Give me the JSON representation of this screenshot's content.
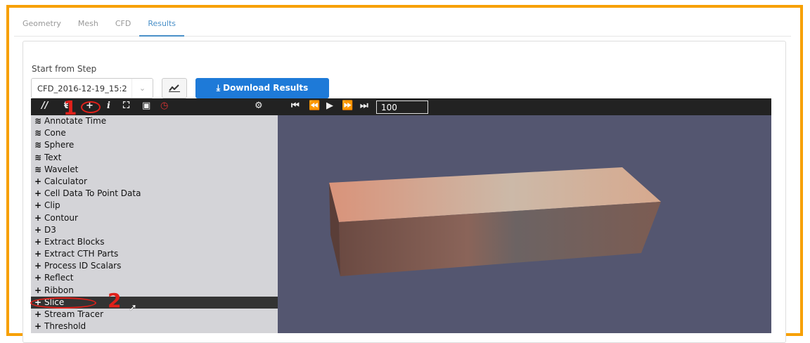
{
  "tabs": [
    "Geometry",
    "Mesh",
    "CFD",
    "Results"
  ],
  "active_tab": "Results",
  "start_label": "Start from Step",
  "step_select": {
    "value": "CFD_2016-12-19_15:2"
  },
  "download_label": "Download Results",
  "toolbar": {
    "step_value": "100"
  },
  "list": [
    {
      "icon": "database",
      "label": "Annotate Time"
    },
    {
      "icon": "database",
      "label": "Cone"
    },
    {
      "icon": "database",
      "label": "Sphere"
    },
    {
      "icon": "database",
      "label": "Text"
    },
    {
      "icon": "database",
      "label": "Wavelet"
    },
    {
      "icon": "plus",
      "label": "Calculator"
    },
    {
      "icon": "plus",
      "label": "Cell Data To Point Data"
    },
    {
      "icon": "plus",
      "label": "Clip"
    },
    {
      "icon": "plus",
      "label": "Contour"
    },
    {
      "icon": "plus",
      "label": "D3"
    },
    {
      "icon": "plus",
      "label": "Extract Blocks"
    },
    {
      "icon": "plus",
      "label": "Extract CTH Parts"
    },
    {
      "icon": "plus",
      "label": "Process ID Scalars"
    },
    {
      "icon": "plus",
      "label": "Reflect"
    },
    {
      "icon": "plus",
      "label": "Ribbon"
    },
    {
      "icon": "plus",
      "label": "Slice",
      "selected": true
    },
    {
      "icon": "plus",
      "label": "Stream Tracer"
    },
    {
      "icon": "plus",
      "label": "Threshold"
    }
  ],
  "annotations": [
    "1",
    "2"
  ],
  "colors": {
    "accent": "#f7a000",
    "primary": "#1e7ad8",
    "viewport": "#545670"
  }
}
